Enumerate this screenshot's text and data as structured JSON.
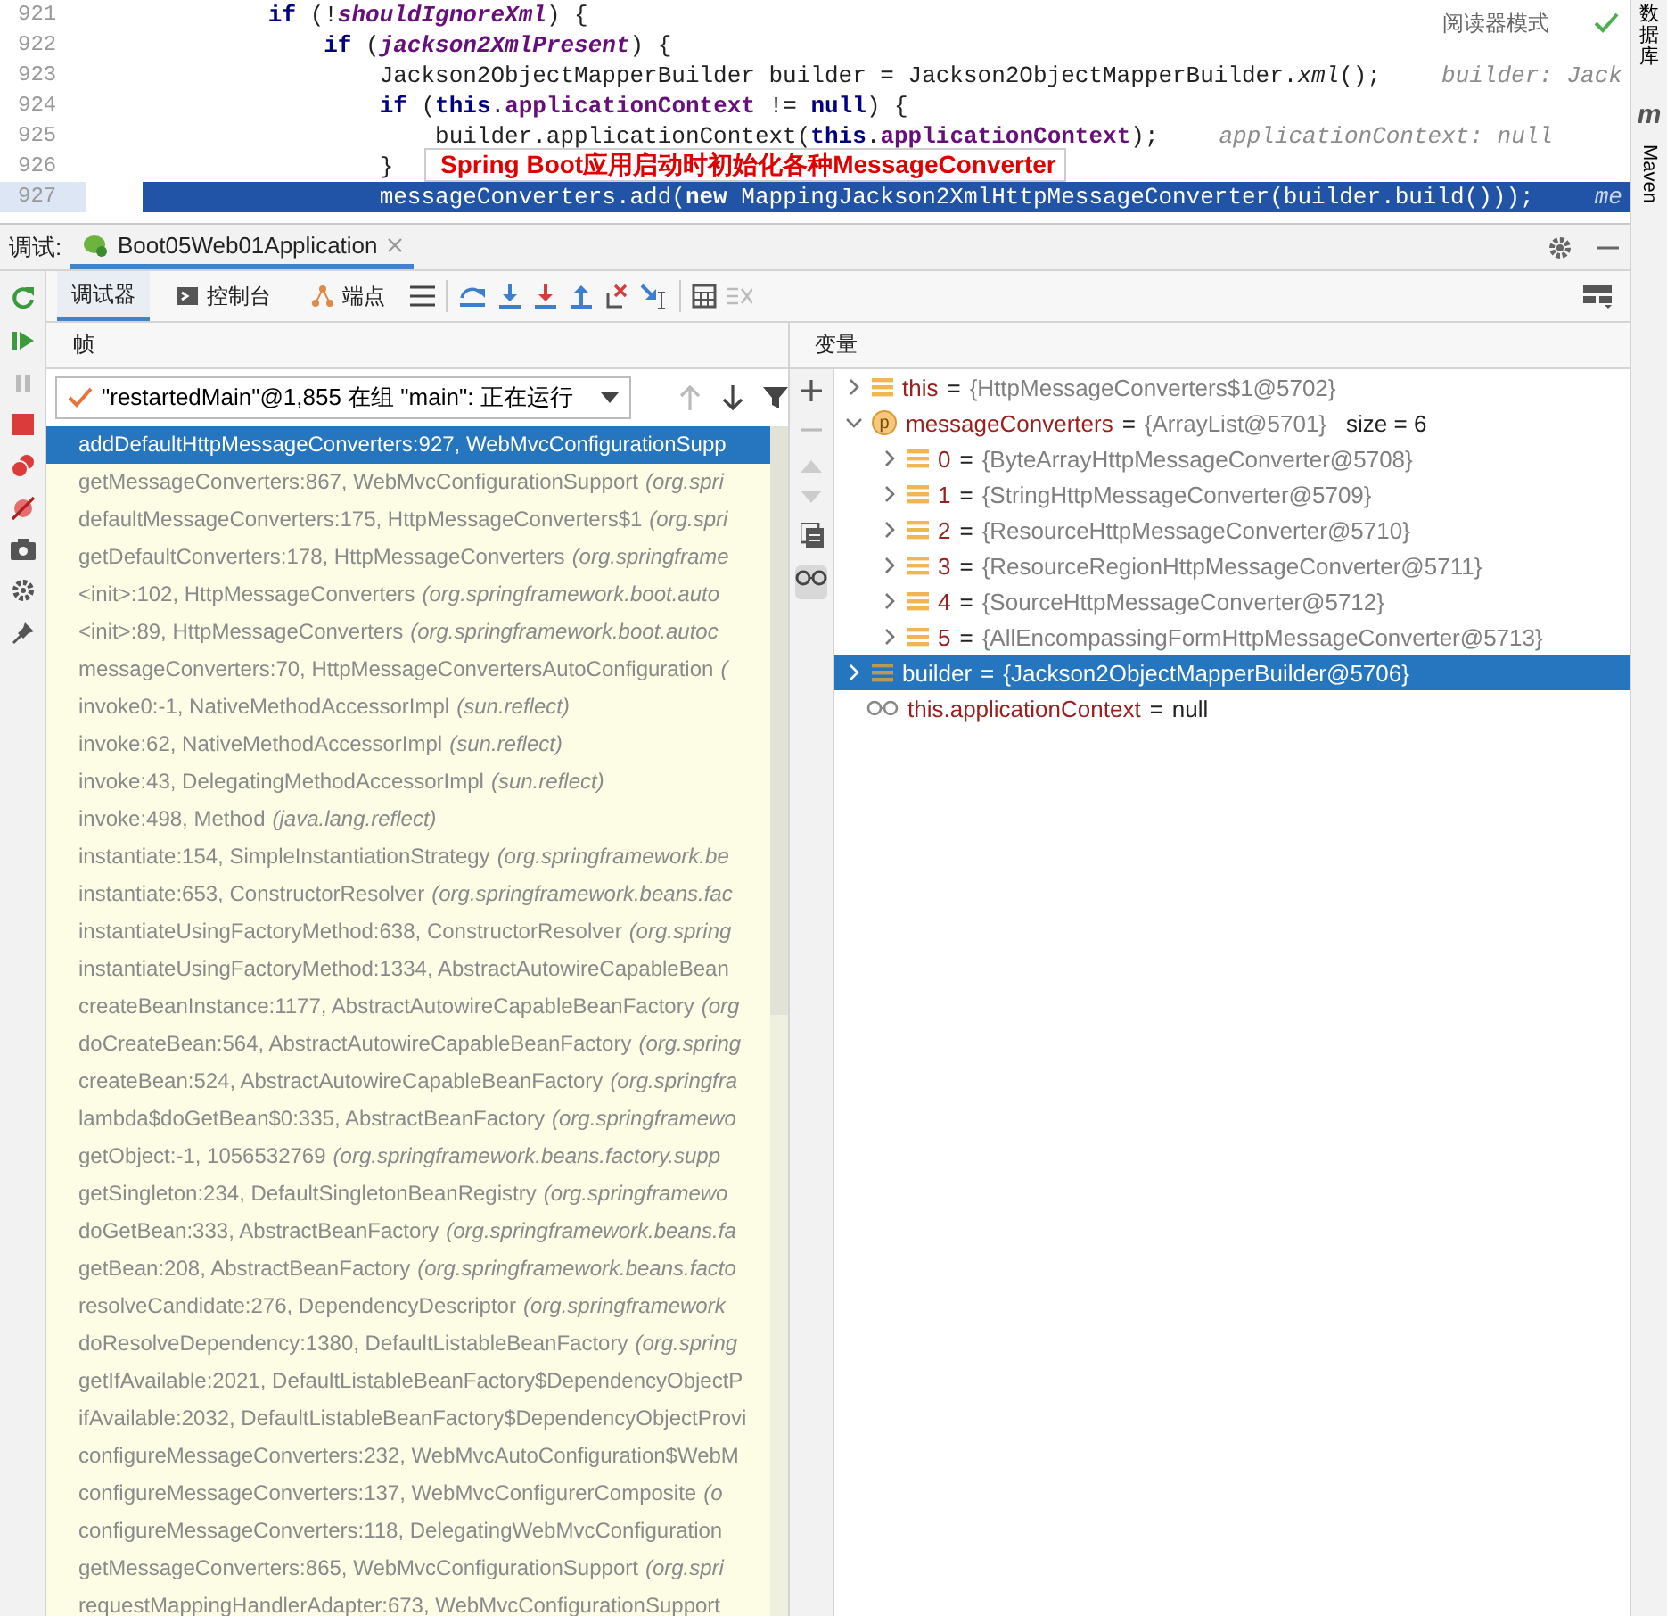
{
  "editor": {
    "lines": [
      {
        "number": "921",
        "selected": false,
        "segments": [
          {
            "text": "        if",
            "kind": "keyword"
          },
          {
            "text": " (!",
            "kind": "plain"
          },
          {
            "text": "shouldIgnoreXml",
            "kind": "static"
          },
          {
            "text": ") {",
            "kind": "plain"
          }
        ]
      },
      {
        "number": "922",
        "selected": false,
        "segments": [
          {
            "text": "            if",
            "kind": "keyword"
          },
          {
            "text": " (",
            "kind": "plain"
          },
          {
            "text": "jackson2XmlPresent",
            "kind": "static"
          },
          {
            "text": ") {",
            "kind": "plain"
          }
        ]
      },
      {
        "number": "923",
        "selected": false,
        "segments": [
          {
            "text": "                Jackson2ObjectMapperBuilder builder = Jackson2ObjectMapperBuilder.",
            "kind": "plain"
          },
          {
            "text": "xml",
            "kind": "italic"
          },
          {
            "text": "();",
            "kind": "plain"
          }
        ],
        "hint": "builder: Jack"
      },
      {
        "number": "924",
        "selected": false,
        "segments": [
          {
            "text": "                if",
            "kind": "keyword"
          },
          {
            "text": " (",
            "kind": "plain"
          },
          {
            "text": "this",
            "kind": "keyword"
          },
          {
            "text": ".",
            "kind": "plain"
          },
          {
            "text": "applicationContext",
            "kind": "field"
          },
          {
            "text": " != ",
            "kind": "plain"
          },
          {
            "text": "null",
            "kind": "keyword"
          },
          {
            "text": ") {",
            "kind": "plain"
          }
        ]
      },
      {
        "number": "925",
        "selected": false,
        "segments": [
          {
            "text": "                    builder.applicationContext(",
            "kind": "plain"
          },
          {
            "text": "this",
            "kind": "keyword"
          },
          {
            "text": ".",
            "kind": "plain"
          },
          {
            "text": "applicationContext",
            "kind": "field"
          },
          {
            "text": ");",
            "kind": "plain"
          }
        ],
        "hint": "applicationContext: null"
      },
      {
        "number": "926",
        "selected": false,
        "segments": [
          {
            "text": "                }",
            "kind": "plain"
          }
        ]
      },
      {
        "number": "927",
        "selected": true,
        "segments": [
          {
            "text": "                messageConverters.add(",
            "kind": "plain"
          },
          {
            "text": "new",
            "kind": "keyword"
          },
          {
            "text": " MappingJackson2XmlHttpMessageConverter(builder.build()));",
            "kind": "plain"
          }
        ],
        "hint": "me"
      }
    ],
    "reader_mode": "阅读器模式",
    "annotation": "Spring Boot应用启动时初始化各种MessageConverter"
  },
  "right_strip": {
    "items": [
      {
        "label": "数据库",
        "kind": "cjk"
      },
      {
        "label": "Maven",
        "kind": "latin",
        "icon_letter": "m"
      }
    ]
  },
  "debug": {
    "label": "调试:",
    "session_tab": {
      "label": "Boot05Web01Application",
      "selected": true
    }
  },
  "toolbar": {
    "tabs": [
      {
        "label": "调试器",
        "selected": true
      },
      {
        "label": "控制台",
        "selected": false
      },
      {
        "label": "端点",
        "selected": false
      }
    ]
  },
  "frames": {
    "title": "帧",
    "thread": "\"restartedMain\"@1,855 在组 \"main\": 正在运行",
    "items": [
      {
        "method": "addDefaultHttpMessageConverters:927, WebMvcConfigurationSupp",
        "selected": true
      },
      {
        "method": "getMessageConverters:867, WebMvcConfigurationSupport",
        "package": "(org.spri",
        "selected": false
      },
      {
        "method": "defaultMessageConverters:175, HttpMessageConverters$1",
        "package": "(org.spri",
        "selected": false
      },
      {
        "method": "getDefaultConverters:178, HttpMessageConverters",
        "package": "(org.springframe",
        "selected": false
      },
      {
        "method": "<init>:102, HttpMessageConverters",
        "package": "(org.springframework.boot.auto",
        "selected": false
      },
      {
        "method": "<init>:89, HttpMessageConverters",
        "package": "(org.springframework.boot.autoc",
        "selected": false
      },
      {
        "method": "messageConverters:70, HttpMessageConvertersAutoConfiguration",
        "package": "(",
        "selected": false
      },
      {
        "method": "invoke0:-1, NativeMethodAccessorImpl",
        "package": "(sun.reflect)",
        "selected": false
      },
      {
        "method": "invoke:62, NativeMethodAccessorImpl",
        "package": "(sun.reflect)",
        "selected": false
      },
      {
        "method": "invoke:43, DelegatingMethodAccessorImpl",
        "package": "(sun.reflect)",
        "selected": false
      },
      {
        "method": "invoke:498, Method",
        "package": "(java.lang.reflect)",
        "selected": false
      },
      {
        "method": "instantiate:154, SimpleInstantiationStrategy",
        "package": "(org.springframework.be",
        "selected": false
      },
      {
        "method": "instantiate:653, ConstructorResolver",
        "package": "(org.springframework.beans.fac",
        "selected": false
      },
      {
        "method": "instantiateUsingFactoryMethod:638, ConstructorResolver",
        "package": "(org.spring",
        "selected": false
      },
      {
        "method": "instantiateUsingFactoryMethod:1334, AbstractAutowireCapableBean",
        "selected": false
      },
      {
        "method": "createBeanInstance:1177, AbstractAutowireCapableBeanFactory",
        "package": "(org",
        "selected": false
      },
      {
        "method": "doCreateBean:564, AbstractAutowireCapableBeanFactory",
        "package": "(org.spring",
        "selected": false
      },
      {
        "method": "createBean:524, AbstractAutowireCapableBeanFactory",
        "package": "(org.springfra",
        "selected": false
      },
      {
        "method": "lambda$doGetBean$0:335, AbstractBeanFactory",
        "package": "(org.springframewo",
        "selected": false
      },
      {
        "method": "getObject:-1, 1056532769",
        "package": "(org.springframework.beans.factory.supp",
        "selected": false
      },
      {
        "method": "getSingleton:234, DefaultSingletonBeanRegistry",
        "package": "(org.springframewo",
        "selected": false
      },
      {
        "method": "doGetBean:333, AbstractBeanFactory",
        "package": "(org.springframework.beans.fa",
        "selected": false
      },
      {
        "method": "getBean:208, AbstractBeanFactory",
        "package": "(org.springframework.beans.facto",
        "selected": false
      },
      {
        "method": "resolveCandidate:276, DependencyDescriptor",
        "package": "(org.springframework",
        "selected": false
      },
      {
        "method": "doResolveDependency:1380, DefaultListableBeanFactory",
        "package": "(org.spring",
        "selected": false
      },
      {
        "method": "getIfAvailable:2021, DefaultListableBeanFactory$DependencyObjectP",
        "selected": false
      },
      {
        "method": "ifAvailable:2032, DefaultListableBeanFactory$DependencyObjectProvi",
        "selected": false
      },
      {
        "method": "configureMessageConverters:232, WebMvcAutoConfiguration$WebM",
        "selected": false
      },
      {
        "method": "configureMessageConverters:137, WebMvcConfigurerComposite",
        "package": "(o",
        "selected": false
      },
      {
        "method": "configureMessageConverters:118, DelegatingWebMvcConfiguration",
        "selected": false
      },
      {
        "method": "getMessageConverters:865, WebMvcConfigurationSupport",
        "package": "(org.spri",
        "selected": false
      },
      {
        "method": "requestMappingHandlerAdapter:673, WebMvcConfigurationSupport",
        "selected": false
      }
    ]
  },
  "variables": {
    "title": "变量",
    "items": [
      {
        "kind": "field",
        "name": "this",
        "eq": "=",
        "value": "{HttpMessageConverters$1@5702}",
        "expanded": false,
        "selected": false
      },
      {
        "kind": "param",
        "icon_letter": "p",
        "name": "messageConverters",
        "eq": "=",
        "value": "{ArrayList@5701}",
        "extra": "size = 6",
        "expanded": true,
        "selected": false,
        "children": [
          {
            "kind": "field",
            "name": "0",
            "eq": "=",
            "value": "{ByteArrayHttpMessageConverter@5708}",
            "expanded": false,
            "selected": false
          },
          {
            "kind": "field",
            "name": "1",
            "eq": "=",
            "value": "{StringHttpMessageConverter@5709}",
            "expanded": false,
            "selected": false
          },
          {
            "kind": "field",
            "name": "2",
            "eq": "=",
            "value": "{ResourceHttpMessageConverter@5710}",
            "expanded": false,
            "selected": false
          },
          {
            "kind": "field",
            "name": "3",
            "eq": "=",
            "value": "{ResourceRegionHttpMessageConverter@5711}",
            "expanded": false,
            "selected": false
          },
          {
            "kind": "field",
            "name": "4",
            "eq": "=",
            "value": "{SourceHttpMessageConverter@5712}",
            "expanded": false,
            "selected": false
          },
          {
            "kind": "field",
            "name": "5",
            "eq": "=",
            "value": "{AllEncompassingFormHttpMessageConverter@5713}",
            "expanded": false,
            "selected": false
          }
        ]
      },
      {
        "kind": "field",
        "name": "builder",
        "eq": "=",
        "value": "{Jackson2ObjectMapperBuilder@5706}",
        "expanded": false,
        "selected": true
      },
      {
        "kind": "watch",
        "name": "this.applicationContext",
        "eq": "=",
        "value": "null",
        "selected": false
      }
    ]
  }
}
